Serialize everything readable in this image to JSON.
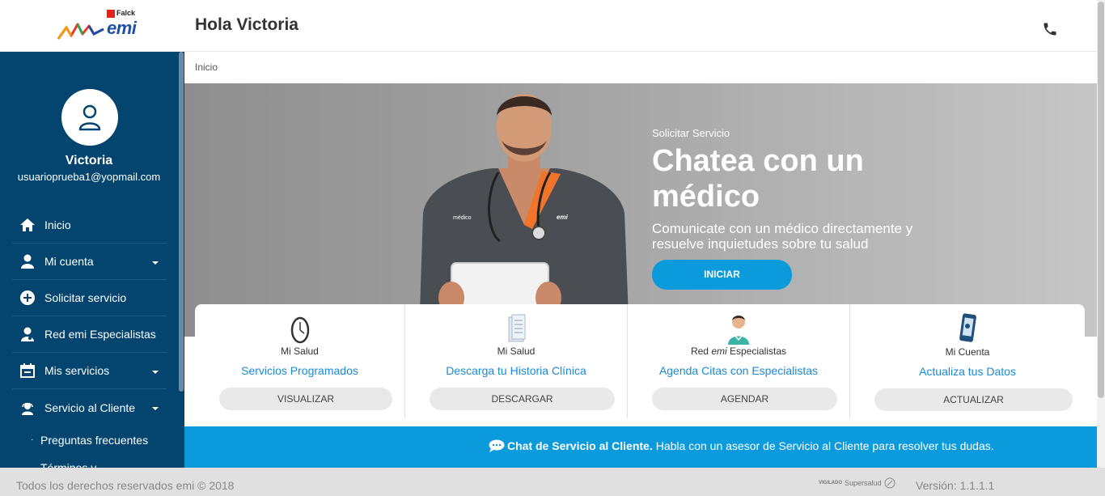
{
  "header": {
    "logo_brand": "emi",
    "logo_partner": "Falck",
    "greeting": "Hola Victoria",
    "phone_icon": "phone-icon"
  },
  "sidebar": {
    "user_name": "Victoria",
    "user_email": "usuarioprueba1@yopmail.com",
    "items": [
      {
        "label": "Inicio",
        "icon": "home-icon"
      },
      {
        "label": "Mi cuenta",
        "icon": "user-icon"
      },
      {
        "label": "Solicitar servicio",
        "icon": "plus-circle-icon"
      },
      {
        "label": "Red emi Especialistas",
        "icon": "doctor-icon"
      },
      {
        "label": "Mis servicios",
        "icon": "calendar-icon"
      },
      {
        "label": "Servicio al Cliente",
        "icon": "headset-icon"
      }
    ],
    "subitems": [
      {
        "label": "Preguntas frecuentes"
      },
      {
        "label": "Términos y"
      }
    ]
  },
  "breadcrumb": {
    "label": "Inicio"
  },
  "hero": {
    "subtitle": "Solicitar Servicio",
    "title": "Chatea con un médico",
    "description": "Comunicate con un médico directamente y resuelve inquietudes sobre tu salud",
    "button_label": "INICIAR",
    "badge_text": "médico"
  },
  "cards": [
    {
      "category": "Mi Salud",
      "link": "Servicios Programados",
      "button": "VISUALIZAR",
      "icon": "clock-icon"
    },
    {
      "category": "Mi Salud",
      "link": "Descarga tu Historia Clínica",
      "button": "DESCARGAR",
      "icon": "document-icon"
    },
    {
      "category_prefix": "Red ",
      "category_em": "emi",
      "category_suffix": " Especialistas",
      "link": "Agenda Citas con Especialistas",
      "button": "AGENDAR",
      "icon": "nurse-icon"
    },
    {
      "category": "Mi Cuenta",
      "link": "Actualiza tus Datos",
      "button": "ACTUALIZAR",
      "icon": "mobile-icon"
    }
  ],
  "chat": {
    "bold": "Chat de Servicio al Cliente.",
    "text": "Habla con un asesor de Servicio al Cliente para resolver tus dudas."
  },
  "footer": {
    "copyright": "Todos los derechos reservados emi © 2018",
    "vigilado": "VIGILADO",
    "supersalud": "Supersalud",
    "version": "Versión: 1.1.1.1"
  },
  "colors": {
    "sidebar": "#03456e",
    "accent": "#0b9bdc",
    "link": "#1a8ad6"
  }
}
